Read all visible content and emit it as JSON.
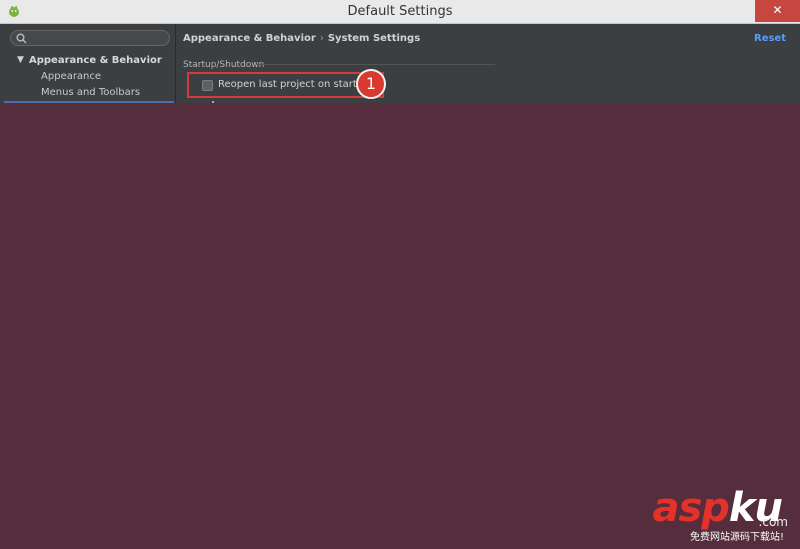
{
  "window": {
    "title": "Default Settings",
    "close_glyph": "✕",
    "app_icon": "android-studio-icon"
  },
  "sidebar": {
    "search": {
      "value": "",
      "placeholder": ""
    },
    "group": {
      "label": "Appearance & Behavior",
      "expanded": true
    },
    "items": [
      {
        "label": "Appearance"
      },
      {
        "label": "Menus and Toolbars"
      }
    ]
  },
  "main": {
    "breadcrumb": {
      "parent": "Appearance & Behavior",
      "separator": "›",
      "current": "System Settings"
    },
    "reset_label": "Reset",
    "section_title": "Startup/Shutdown",
    "reopen_checkbox": {
      "label": "Reopen last project on startup",
      "checked": false
    },
    "annotation_number": "1"
  },
  "watermark": {
    "logo_red": "asp",
    "logo_white": "ku",
    "logo_suffix": ".com",
    "subtitle": "免费网站源码下载站!"
  },
  "colors": {
    "dialog_bg": "#3c3f41",
    "overlay_bg": "#552d3c",
    "accent_blue": "#589df6",
    "highlight_red": "#d73a3a"
  }
}
